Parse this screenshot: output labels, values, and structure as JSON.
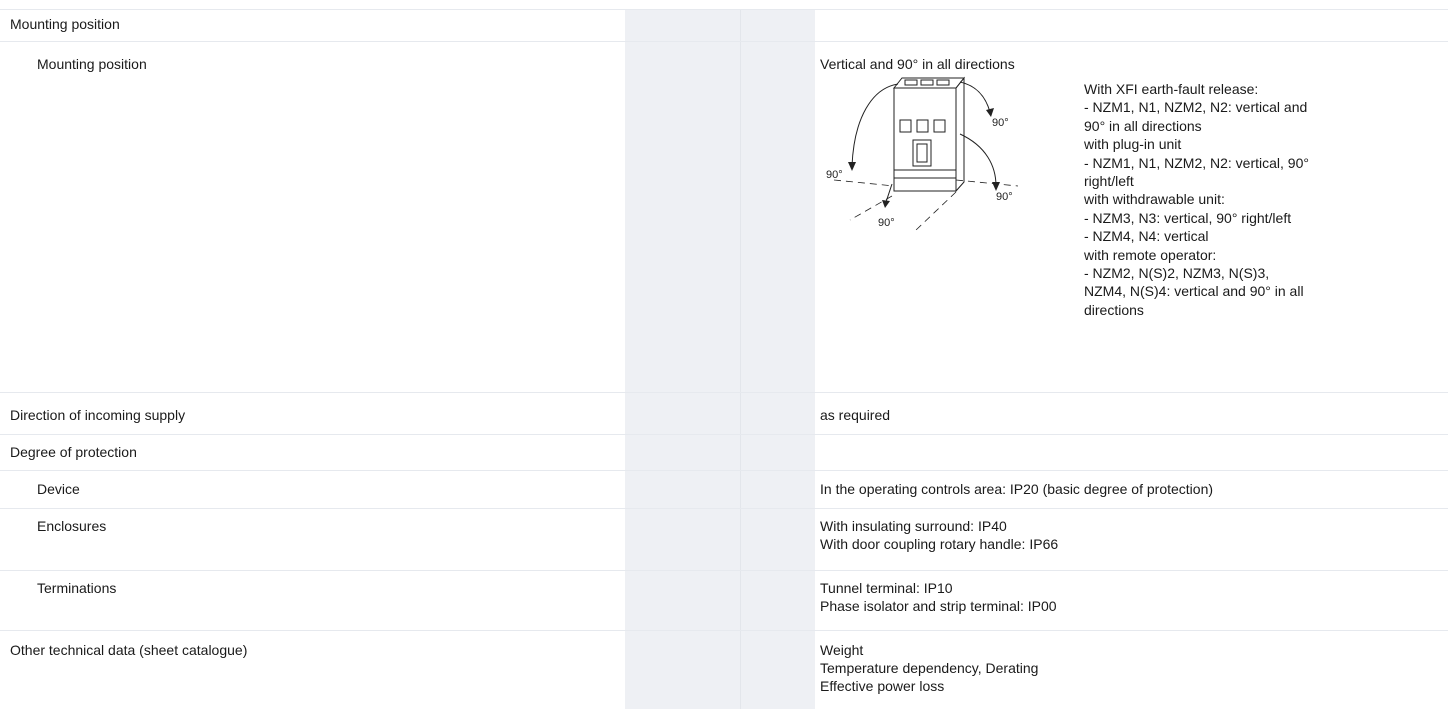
{
  "rows": [
    {
      "label": "Mounting position",
      "value": ""
    },
    {
      "label": "Mounting position",
      "value": "Vertical and 90° in all directions"
    },
    {
      "label": "Direction of incoming supply",
      "value": "as required"
    },
    {
      "label": "Degree of protection",
      "value": ""
    },
    {
      "label": "Device",
      "value": "In the operating controls area: IP20 (basic degree of protection)"
    },
    {
      "label": "Enclosures",
      "value": [
        "With insulating surround: IP40",
        "With door coupling rotary handle: IP66"
      ]
    },
    {
      "label": "Terminations",
      "value": [
        "Tunnel terminal: IP10",
        "Phase isolator and strip terminal: IP00"
      ]
    },
    {
      "label": "Other technical data (sheet catalogue)",
      "value": [
        "Weight",
        "Temperature dependency, Derating",
        "Effective power loss"
      ]
    }
  ],
  "diagram": {
    "angle_labels": [
      "90°",
      "90°",
      "90°",
      "90°"
    ]
  },
  "xfi_note": [
    "With XFI earth-fault release:",
    "- NZM1, N1, NZM2, N2: vertical and",
    "90° in all directions",
    "with plug-in unit",
    "- NZM1, N1, NZM2, N2: vertical, 90°",
    "right/left",
    "with withdrawable unit:",
    "- NZM3, N3: vertical, 90° right/left",
    "- NZM4, N4: vertical",
    "with remote operator:",
    "- NZM2, N(S)2, NZM3, N(S)3,",
    "NZM4, N(S)4: vertical and 90° in all",
    "directions"
  ]
}
